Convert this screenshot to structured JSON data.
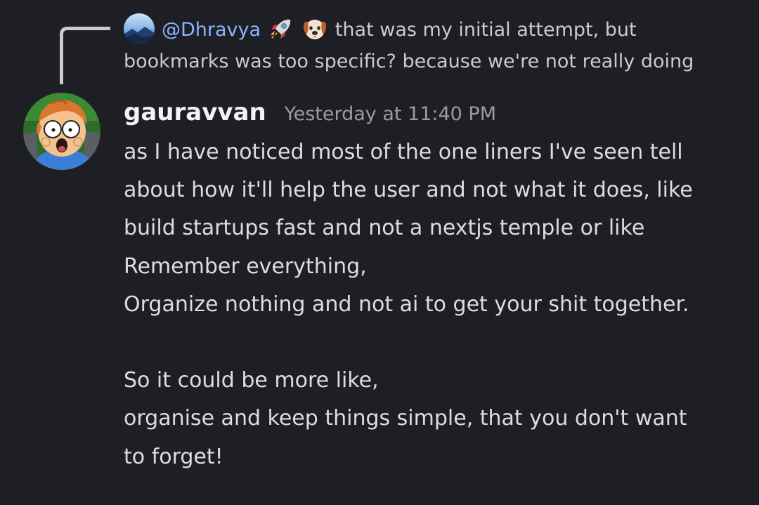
{
  "reply": {
    "mention": "@Dhravya",
    "emojis": [
      "rocket-emoji",
      "dog-emoji"
    ],
    "text": "that was my initial attempt, but bookmarks was too specific? because we're not really doing"
  },
  "message": {
    "username": "gauravvan",
    "timestamp": "Yesterday at 11:40 PM",
    "lines": [
      "as I have noticed most of the one liners I've seen tell",
      "about how it'll help the user and not what it does, like",
      "build startups fast and not a nextjs temple or like",
      "Remember everything,",
      "Organize nothing and not ai to get your shit together.",
      "",
      "So it could be more like,",
      "organise and keep things simple, that you don't want",
      "to forget!"
    ]
  },
  "colors": {
    "background": "#1e1f24",
    "mention": "#8ab4ff",
    "username": "#f2f3f5",
    "timestamp": "#9a9ca3",
    "body_text": "#dbdee1"
  }
}
